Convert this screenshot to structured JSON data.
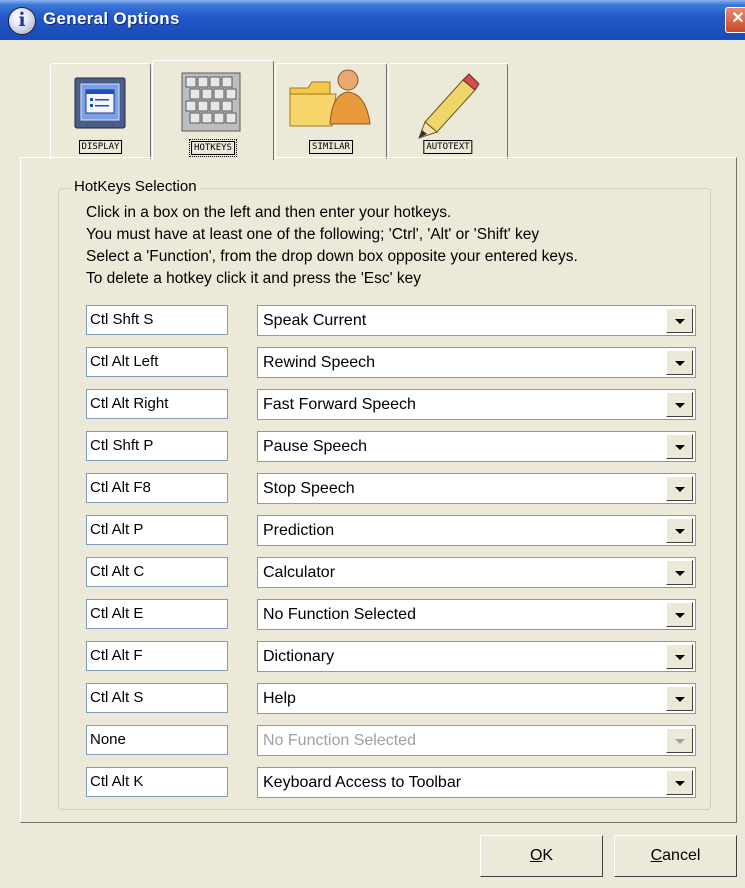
{
  "window": {
    "title": "General Options"
  },
  "tabs": [
    {
      "label": "DISPLAY",
      "icon": "display-icon"
    },
    {
      "label": "HOTKEYS",
      "icon": "keyboard-icon",
      "active": true
    },
    {
      "label": "SIMILAR",
      "icon": "folder-person-icon"
    },
    {
      "label": "AUTOTEXT",
      "icon": "pencil-icon"
    }
  ],
  "hotkeys": {
    "group_title": "HotKeys Selection",
    "instructions": [
      "Click in a box on the left and then enter your hotkeys.",
      "You must have at least one of the following; 'Ctrl', 'Alt' or 'Shift' key",
      "Select a 'Function', from the drop down box opposite your entered keys.",
      "To delete a hotkey click it and press the 'Esc' key"
    ],
    "rows": [
      {
        "key": "Ctl Shft S",
        "function": "Speak Current"
      },
      {
        "key": "Ctl Alt Left",
        "function": "Rewind Speech"
      },
      {
        "key": "Ctl Alt Right",
        "function": "Fast Forward Speech"
      },
      {
        "key": "Ctl Shft P",
        "function": "Pause Speech"
      },
      {
        "key": "Ctl Alt F8",
        "function": "Stop Speech"
      },
      {
        "key": "Ctl Alt P",
        "function": "Prediction"
      },
      {
        "key": "Ctl Alt C",
        "function": "Calculator"
      },
      {
        "key": "Ctl Alt E",
        "function": "No Function Selected"
      },
      {
        "key": "Ctl Alt F",
        "function": "Dictionary"
      },
      {
        "key": "Ctl Alt S",
        "function": "Help"
      },
      {
        "key": "None",
        "function": "No Function Selected",
        "disabled": true
      },
      {
        "key": "Ctl Alt K",
        "function": "Keyboard Access to Toolbar"
      }
    ]
  },
  "buttons": {
    "ok": {
      "mnemonic": "O",
      "rest": "K"
    },
    "cancel": {
      "mnemonic": "C",
      "rest": "ancel"
    }
  },
  "colors": {
    "titlebar": "#2459c9",
    "face": "#ece9d8"
  }
}
